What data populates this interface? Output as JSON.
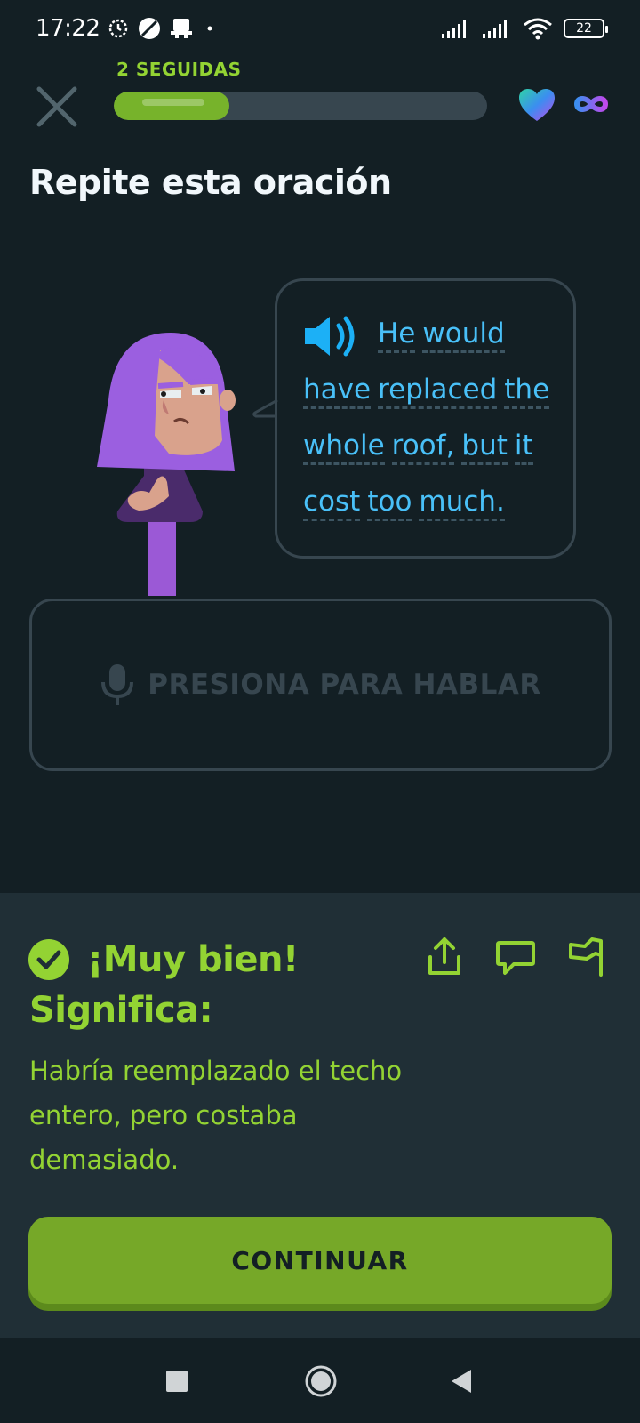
{
  "status_bar": {
    "time": "17:22",
    "battery": "22",
    "icons": [
      "alarm-icon",
      "dnd-icon",
      "inbox-icon",
      "dot-icon",
      "signal-icon",
      "signal-icon",
      "wifi-icon",
      "battery-icon"
    ]
  },
  "header": {
    "streak_label": "2 SEGUIDAS",
    "progress_fraction": 0.31,
    "close_icon": "close-icon",
    "hearts_icon": "heart-icon",
    "hearts_value_icon": "infinity-icon"
  },
  "prompt": {
    "title": "Repite esta oración"
  },
  "bubble": {
    "lines": [
      [
        "He",
        "would"
      ],
      [
        "have",
        "replaced",
        "the"
      ],
      [
        "whole",
        "roof,",
        "but",
        "it"
      ],
      [
        "cost",
        "too",
        "much."
      ]
    ]
  },
  "mic": {
    "label": "PRESIONA PARA HABLAR"
  },
  "feedback": {
    "title": "¡Muy bien!",
    "subtitle": "Significa:",
    "translation": "Habría reemplazado el techo entero, pero costaba demasiado.",
    "continue_label": "CONTINUAR"
  },
  "colors": {
    "background": "#131f24",
    "panel": "#202f36",
    "accent_green": "#93d333",
    "button_green": "#76a828",
    "text_blue": "#49c0f8",
    "border": "#37464f"
  }
}
